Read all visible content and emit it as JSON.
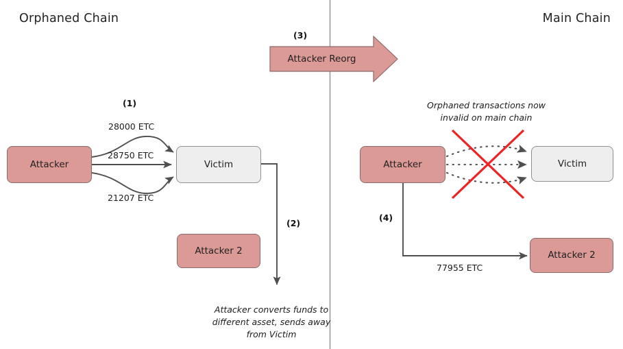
{
  "diagram": {
    "title_left": "Orphaned Chain",
    "title_right": "Main Chain",
    "colors": {
      "attacker_fill": "#dc9a97",
      "attacker_stroke": "#8c6a69",
      "victim_fill": "#eeeeee",
      "victim_stroke": "#8f8f8f",
      "edge": "#555555",
      "invalid_cross": "#ee2222",
      "divider": "#999999",
      "background": "#ffffff"
    }
  },
  "left_chain": {
    "nodes": {
      "attacker": "Attacker",
      "victim": "Victim",
      "attacker2": "Attacker 2"
    },
    "edges": [
      {
        "label": "28000 ETC",
        "from": "attacker",
        "to": "victim"
      },
      {
        "label": "28750 ETC",
        "from": "attacker",
        "to": "victim"
      },
      {
        "label": "21207 ETC",
        "from": "attacker",
        "to": "victim"
      }
    ],
    "steps": {
      "one": "(1)",
      "two": "(2)"
    },
    "note": "Attacker converts funds to different asset, sends away from Victim"
  },
  "reorg": {
    "step": "(3)",
    "label": "Attacker Reorg"
  },
  "right_chain": {
    "nodes": {
      "attacker": "Attacker",
      "victim": "Victim",
      "attacker2": "Attacker 2"
    },
    "note": "Orphaned transactions now invalid on main chain",
    "steps": {
      "four": "(4)"
    },
    "edges": [
      {
        "label": "77955 ETC",
        "from": "attacker",
        "to": "attacker2"
      }
    ]
  }
}
